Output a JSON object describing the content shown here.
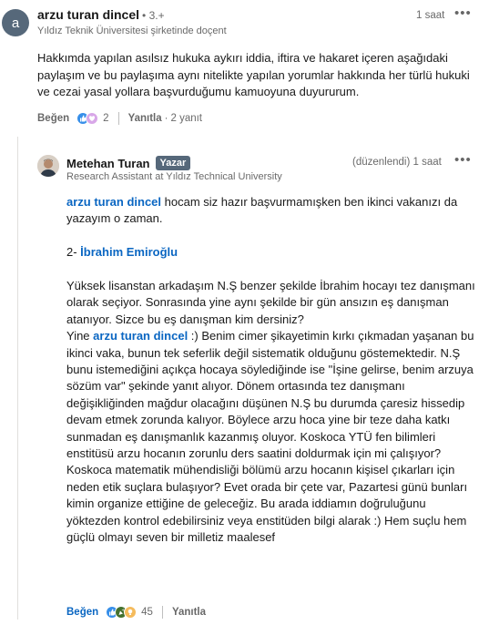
{
  "comment": {
    "avatar_letter": "a",
    "author": "arzu turan dincel",
    "degree": "• 3.+",
    "headline": "Yıldız Teknik Üniversitesi şirketinde doçent",
    "time": "1 saat",
    "more": "•••",
    "text": "Hakkımda yapılan asılsız hukuka aykırı iddia, iftira ve hakaret içeren aşağıdaki paylaşım ve bu paylaşıma aynı nitelikte yapılan yorumlar  hakkında her türlü hukuki ve cezai yasal yollara  başvurduğumu kamuoyuna duyururum.",
    "like_label": "Beğen",
    "reaction_count": "2",
    "reply_label": "Yanıtla",
    "reply_count": "2 yanıt"
  },
  "reply": {
    "author": "Metehan Turan",
    "badge": "Yazar",
    "headline": "Research Assistant at Yıldız Technical University",
    "time": "(düzenlendi) 1 saat",
    "more": "•••",
    "p1_mention": "arzu turan dincel",
    "p1_text": " hocam siz hazır başvurmamışken ben ikinci vakanızı da yazayım o zaman.",
    "p2_prefix": "2- ",
    "p2_mention": "İbrahim Emiroğlu",
    "p3_text": "Yüksek lisanstan arkadaşım N.Ş benzer şekilde İbrahim hocayı tez danışmanı olarak seçiyor. Sonrasında yine aynı şekilde bir gün ansızın eş danışman atanıyor. Sizce bu eş danışman kim dersiniz?",
    "p4_prefix": "Yine ",
    "p4_mention": "arzu turan dincel",
    "p4_text": " :) Benim cimer şikayetimin kırkı çıkmadan yaşanan bu ikinci vaka, bunun tek seferlik değil sistematik olduğunu göstemektedir. N.Ş bunu istemediğini açıkça hocaya söylediğinde ise \"İşine gelirse, benim arzuya sözüm var\" şekinde yanıt alıyor. Dönem ortasında tez danışmanı değişikliğinden mağdur olacağını düşünen N.Ş bu durumda çaresiz hissedip devam etmek zorunda kalıyor. Böylece arzu hoca yine bir teze daha katkı sunmadan eş danışmanlık kazanmış oluyor. Koskoca YTÜ fen bilimleri enstitüsü arzu hocanın zorunlu ders saatini doldurmak için mi çalışıyor? Koskoca matematik mühendisliği bölümü arzu hocanın kişisel çıkarları için neden etik suçlara bulaşıyor? Evet orada bir çete var, Pazartesi günü bunları kimin organize ettiğine de geleceğiz. Bu arada iddiamın doğruluğunu yöktezden kontrol edebilirsiniz veya enstitüden bilgi alarak :) Hem suçlu hem güçlü olmayı seven bir milletiz maalesef",
    "like_label": "Beğen",
    "reaction_count": "45",
    "reply_label": "Yanıtla"
  },
  "colors": {
    "mention": "#0a66c2",
    "badge_bg": "#56687a",
    "like_reaction": "#378fe9",
    "celebrate_reaction": "#44712e"
  }
}
